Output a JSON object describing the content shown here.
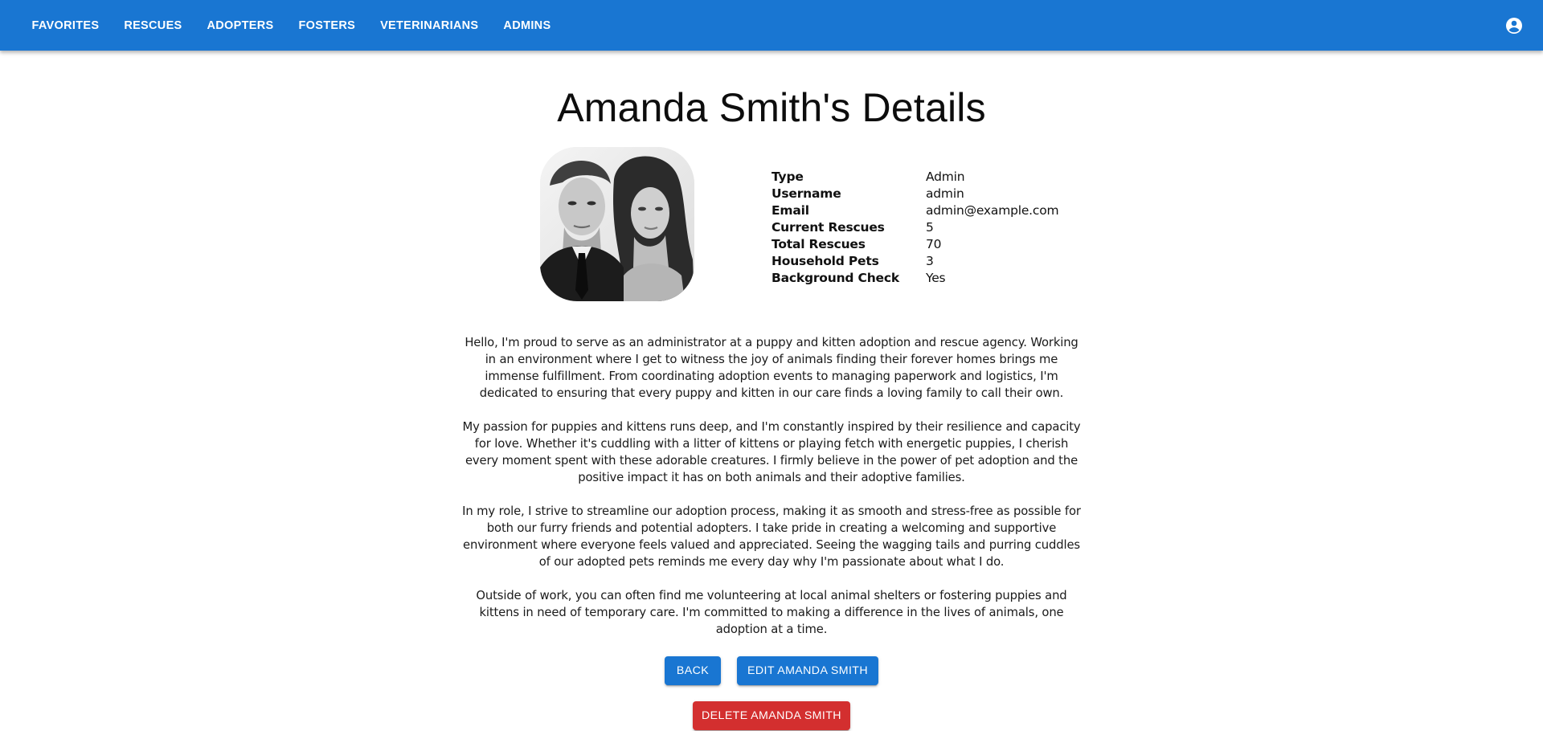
{
  "nav": {
    "items": [
      {
        "label": "FAVORITES"
      },
      {
        "label": "RESCUES"
      },
      {
        "label": "ADOPTERS"
      },
      {
        "label": "FOSTERS"
      },
      {
        "label": "VETERINARIANS"
      },
      {
        "label": "ADMINS"
      }
    ],
    "account_icon": "account-circle-icon"
  },
  "page": {
    "title": "Amanda Smith's Details"
  },
  "profile": {
    "avatar": "couple-portrait-photo",
    "fields": [
      {
        "label": "Type",
        "value": "Admin"
      },
      {
        "label": "Username",
        "value": "admin"
      },
      {
        "label": "Email",
        "value": "admin@example.com"
      },
      {
        "label": "Current Rescues",
        "value": "5"
      },
      {
        "label": "Total Rescues",
        "value": "70"
      },
      {
        "label": "Household Pets",
        "value": "3"
      },
      {
        "label": "Background Check",
        "value": "Yes"
      }
    ],
    "bio": [
      "Hello, I'm proud to serve as an administrator at a puppy and kitten adoption and rescue agency. Working in an environment where I get to witness the joy of animals finding their forever homes brings me immense fulfillment. From coordinating adoption events to managing paperwork and logistics, I'm dedicated to ensuring that every puppy and kitten in our care finds a loving family to call their own.",
      "My passion for puppies and kittens runs deep, and I'm constantly inspired by their resilience and capacity for love. Whether it's cuddling with a litter of kittens or playing fetch with energetic puppies, I cherish every moment spent with these adorable creatures. I firmly believe in the power of pet adoption and the positive impact it has on both animals and their adoptive families.",
      "In my role, I strive to streamline our adoption process, making it as smooth and stress-free as possible for both our furry friends and potential adopters. I take pride in creating a welcoming and supportive environment where everyone feels valued and appreciated. Seeing the wagging tails and purring cuddles of our adopted pets reminds me every day why I'm passionate about what I do.",
      "Outside of work, you can often find me volunteering at local animal shelters or fostering puppies and kittens in need of temporary care. I'm committed to making a difference in the lives of animals, one adoption at a time."
    ]
  },
  "actions": {
    "back_label": "BACK",
    "edit_label": "EDIT AMANDA SMITH",
    "delete_label": "DELETE AMANDA SMITH"
  },
  "colors": {
    "appbar": "#1976d2",
    "primary": "#1976d2",
    "danger": "#d32f2f"
  }
}
